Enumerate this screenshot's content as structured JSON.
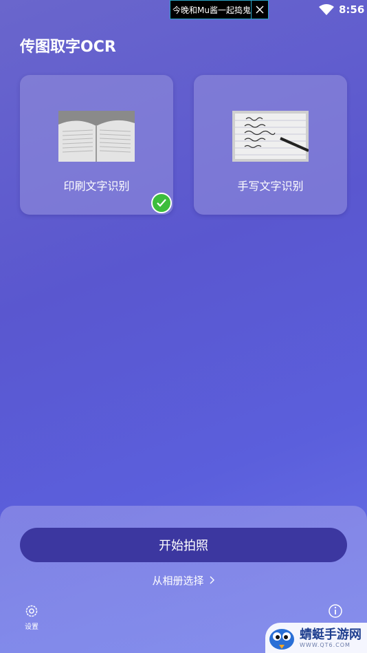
{
  "status_bar": {
    "ad_text": "今晚和Mu酱一起捣鬼",
    "time": "8:56"
  },
  "app": {
    "title": "传图取字OCR"
  },
  "modes": [
    {
      "label": "印刷文字识别",
      "selected": true
    },
    {
      "label": "手写文字识别",
      "selected": false
    }
  ],
  "bottom": {
    "camera_button": "开始拍照",
    "album_link": "从相册选择",
    "settings_label": "设置",
    "about_label": "关于"
  },
  "watermark": {
    "main": "蜻蜓手游网",
    "sub": "WWW.QT6.COM"
  },
  "colors": {
    "accent": "#3c37a0",
    "check": "#3cbd3c",
    "background": "#5a57cf"
  }
}
